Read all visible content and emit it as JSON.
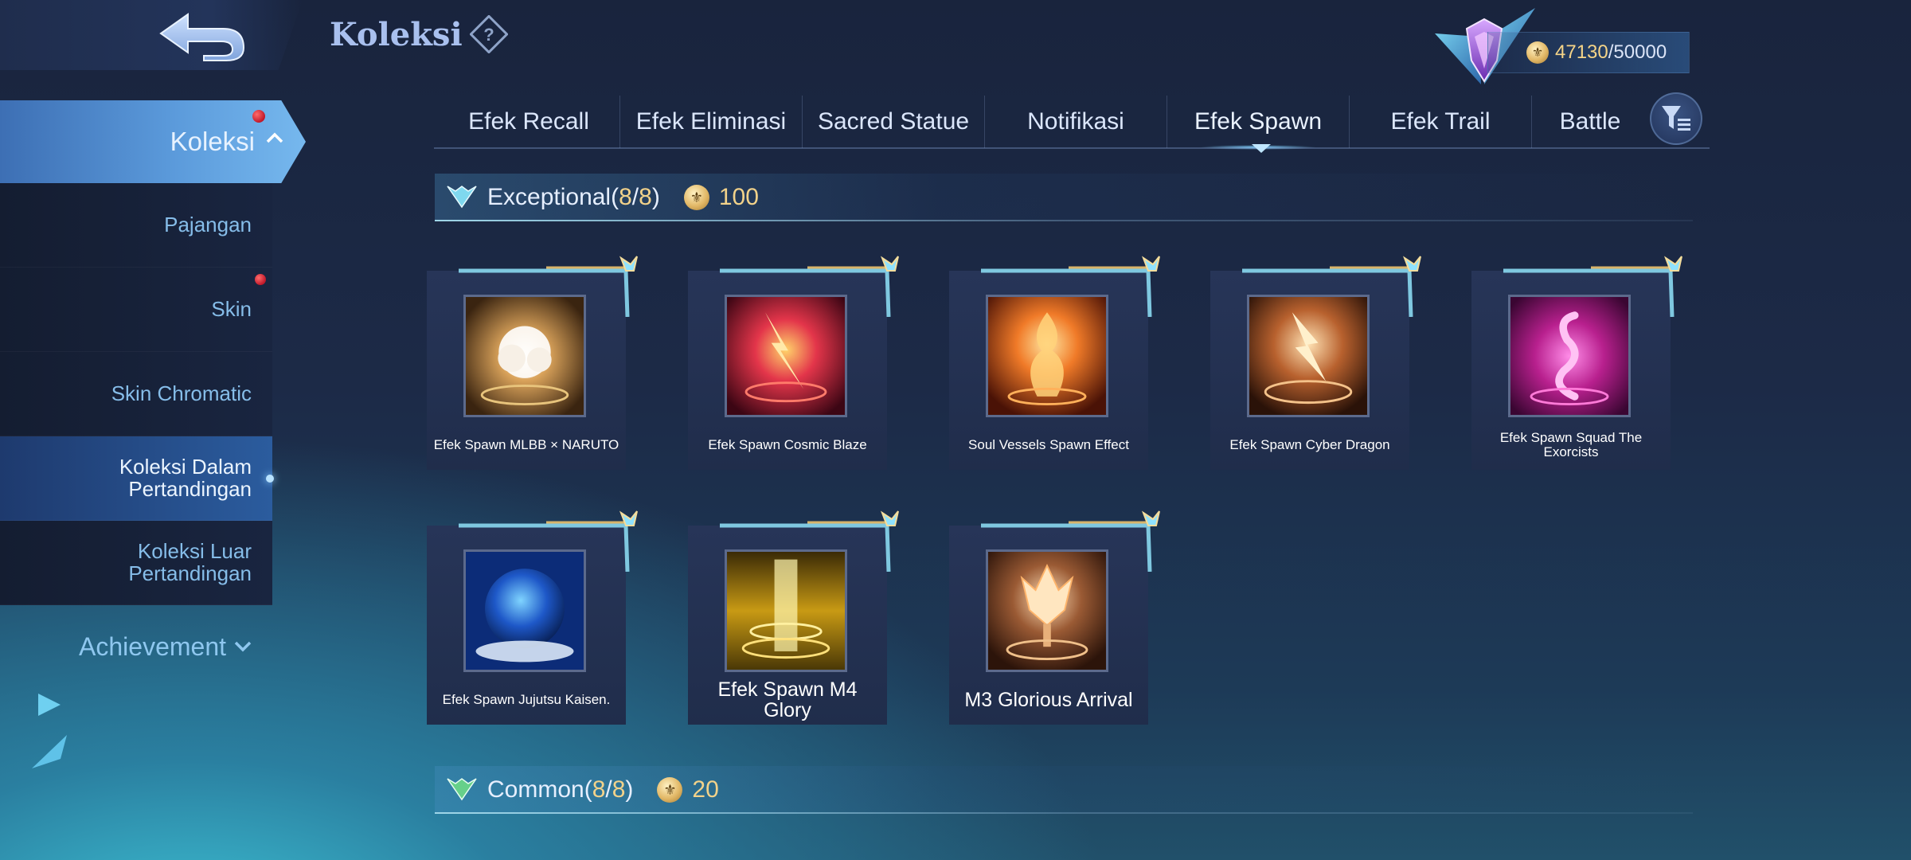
{
  "header": {
    "title": "Koleksi",
    "points_current": "47130",
    "points_separator": "/",
    "points_max": "50000"
  },
  "sidebar": {
    "active": {
      "label": "Koleksi"
    },
    "items": [
      {
        "label": "Pajangan"
      },
      {
        "label": "Skin"
      },
      {
        "label": "Skin Chromatic"
      },
      {
        "label": "Koleksi Dalam Pertandingan"
      },
      {
        "label": "Koleksi Luar Pertandingan"
      }
    ],
    "achievement": "Achievement"
  },
  "tabs": [
    {
      "label": "Efek Recall"
    },
    {
      "label": "Efek Eliminasi"
    },
    {
      "label": "Sacred Statue"
    },
    {
      "label": "Notifikasi"
    },
    {
      "label": "Efek Spawn"
    },
    {
      "label": "Efek Trail"
    },
    {
      "label": "Battle"
    }
  ],
  "active_tab": "Efek Spawn",
  "sections": [
    {
      "title": "Exceptional",
      "count_open": "(",
      "count_owned": "8",
      "count_sep": "/",
      "count_total": "8",
      "count_close": ")",
      "points": "100",
      "items": [
        {
          "label": "Efek Spawn MLBB × NARUTO"
        },
        {
          "label": "Efek Spawn Cosmic Blaze"
        },
        {
          "label": "Soul Vessels Spawn Effect"
        },
        {
          "label": "Efek Spawn Cyber Dragon"
        },
        {
          "label": "Efek Spawn Squad The Exorcists"
        },
        {
          "label": "Efek Spawn Jujutsu Kaisen."
        },
        {
          "label": "Efek Spawn M4 Glory"
        },
        {
          "label": "M3 Glorious Arrival"
        }
      ]
    },
    {
      "title": "Common",
      "count_open": "(",
      "count_owned": "8",
      "count_sep": "/",
      "count_total": "8",
      "count_close": ")",
      "points": "20"
    }
  ],
  "colors": {
    "accent_gold": "#f2d28a",
    "active_blue": "#5a99da",
    "text_blue": "#86bde9"
  }
}
